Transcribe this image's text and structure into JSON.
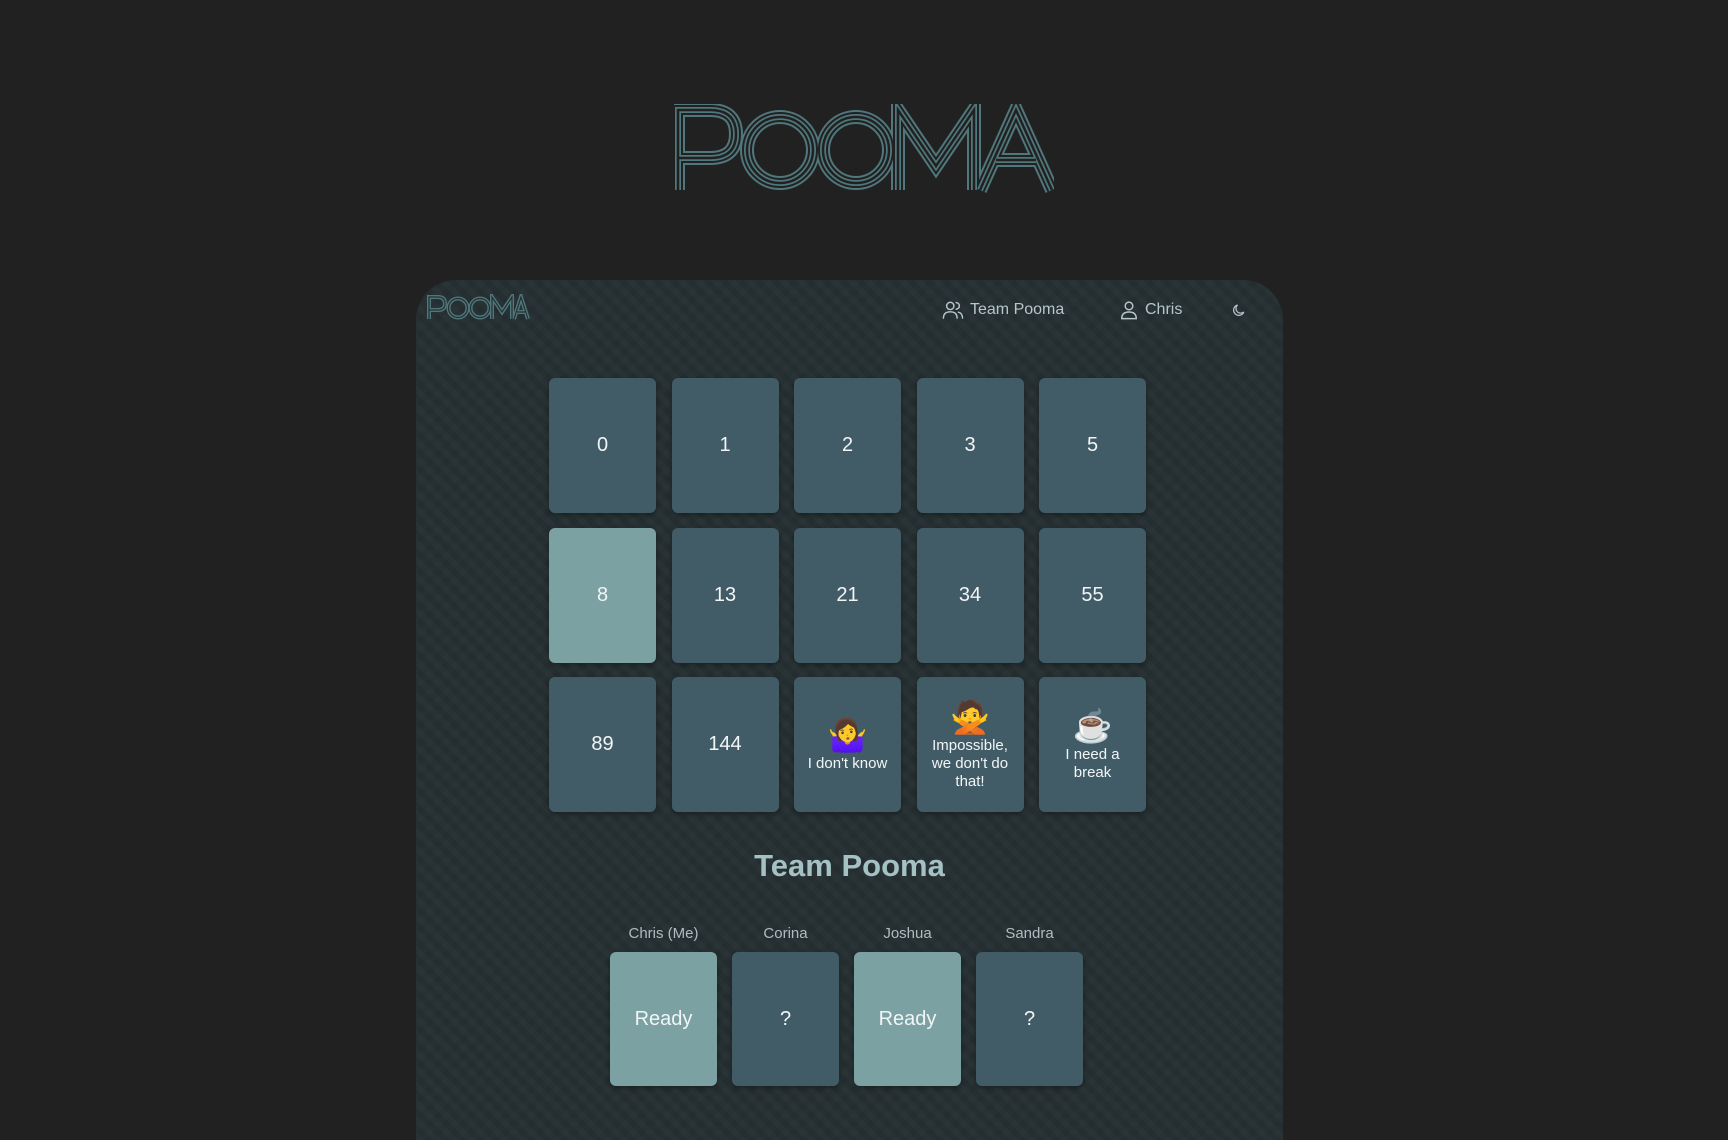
{
  "brand": {
    "name": "POOMA",
    "color": "#4f777c"
  },
  "nav": {
    "team_icon": "users-icon",
    "team_label": "Team Pooma",
    "user_icon": "user-icon",
    "user_label": "Chris",
    "theme_icon": "moon-icon"
  },
  "colors": {
    "card": "#425c67",
    "card_selected": "#7ba1a2",
    "panel": "#263032",
    "page": "#212121"
  },
  "cards": [
    {
      "value": "0",
      "selected": false
    },
    {
      "value": "1",
      "selected": false
    },
    {
      "value": "2",
      "selected": false
    },
    {
      "value": "3",
      "selected": false
    },
    {
      "value": "5",
      "selected": false
    },
    {
      "value": "8",
      "selected": true
    },
    {
      "value": "13",
      "selected": false
    },
    {
      "value": "21",
      "selected": false
    },
    {
      "value": "34",
      "selected": false
    },
    {
      "value": "55",
      "selected": false
    },
    {
      "value": "89",
      "selected": false
    },
    {
      "value": "144",
      "selected": false
    },
    {
      "emoji": "🤷‍♀️",
      "label": "I don't know",
      "selected": false
    },
    {
      "emoji": "🙅",
      "label": "Impossible, we don't do that!",
      "selected": false
    },
    {
      "emoji": "☕",
      "label": "I need a break",
      "selected": false
    }
  ],
  "team": {
    "title": "Team Pooma",
    "players": [
      {
        "name": "Chris (Me)",
        "status": "Ready",
        "ready": true
      },
      {
        "name": "Corina",
        "status": "?",
        "ready": false
      },
      {
        "name": "Joshua",
        "status": "Ready",
        "ready": true
      },
      {
        "name": "Sandra",
        "status": "?",
        "ready": false
      }
    ]
  }
}
